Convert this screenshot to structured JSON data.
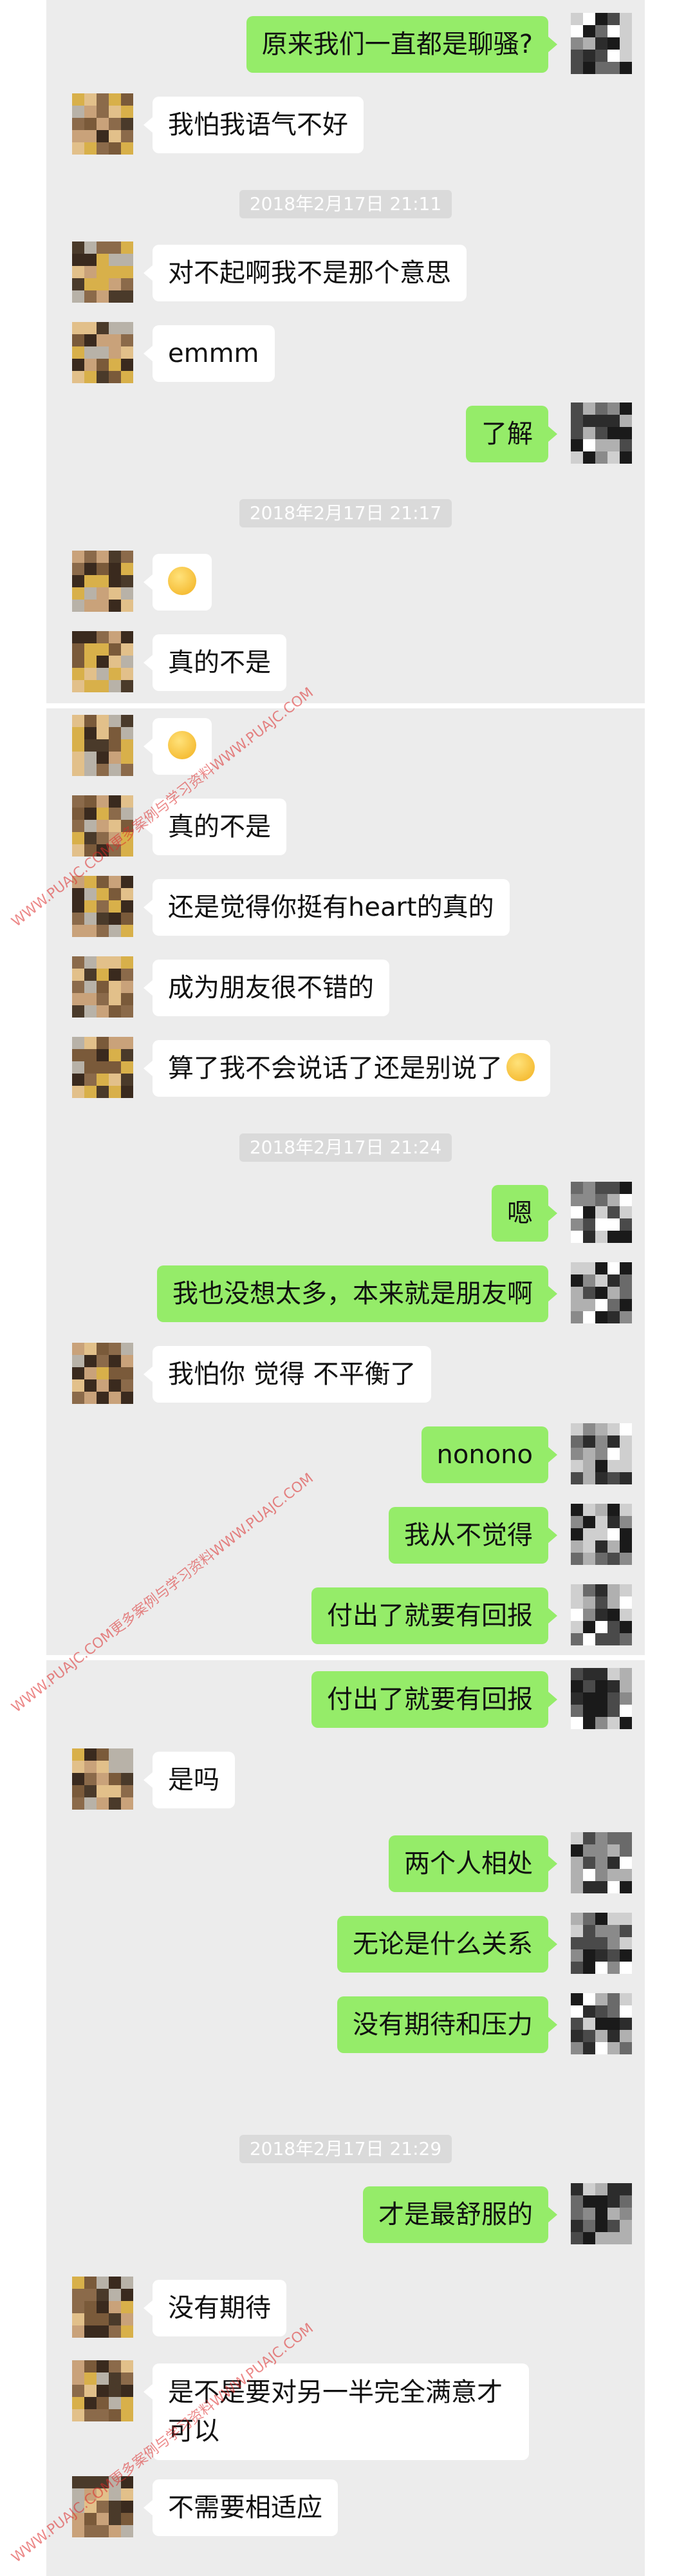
{
  "messages": [
    {
      "side": "out",
      "text": "原来我们一直都是聊骚?"
    },
    {
      "side": "in",
      "text": "我怕我语气不好"
    },
    {
      "side": "in",
      "text": "对不起啊我不是那个意思"
    },
    {
      "side": "in",
      "text": "emmm"
    },
    {
      "side": "out",
      "text": "了解"
    },
    {
      "side": "in",
      "text": ""
    },
    {
      "side": "in",
      "text": "真的不是"
    },
    {
      "side": "in",
      "text": ""
    },
    {
      "side": "in",
      "text": "真的不是"
    },
    {
      "side": "in",
      "text": "还是觉得你挺有heart的真的"
    },
    {
      "side": "in",
      "text": "成为朋友很不错的"
    },
    {
      "side": "in",
      "text": "算了我不会说话了还是别说了"
    },
    {
      "side": "out",
      "text": "嗯"
    },
    {
      "side": "out",
      "text": "我也没想太多，本来就是朋友啊"
    },
    {
      "side": "in",
      "text": "我怕你 觉得 不平衡了"
    },
    {
      "side": "out",
      "text": "nonono"
    },
    {
      "side": "out",
      "text": "我从不觉得"
    },
    {
      "side": "out",
      "text": "付出了就要有回报"
    },
    {
      "side": "out",
      "text": "付出了就要有回报"
    },
    {
      "side": "in",
      "text": "是吗"
    },
    {
      "side": "out",
      "text": "两个人相处"
    },
    {
      "side": "out",
      "text": "无论是什么关系"
    },
    {
      "side": "out",
      "text": "没有期待和压力"
    },
    {
      "side": "out",
      "text": "才是最舒服的"
    },
    {
      "side": "in",
      "text": "没有期待"
    },
    {
      "side": "in",
      "text": "是不是要对另一半完全满意才可以"
    },
    {
      "side": "in",
      "text": "不需要相适应"
    }
  ],
  "timestamps": [
    "2018年2月17日 21:11",
    "2018年2月17日 21:17",
    "2018年2月17日 21:24",
    "2018年2月17日 21:29"
  ],
  "watermarks": [
    "WWW.PUAJC.COM更多案例与学习资料WWW.PUAJC.COM",
    "WWW.PUAJC.COM更多案例与学习资料WWW.PUAJC.COM",
    "WWW.PUAJC.COM更多案例与学习资料WWW.PUAJC.COM"
  ]
}
